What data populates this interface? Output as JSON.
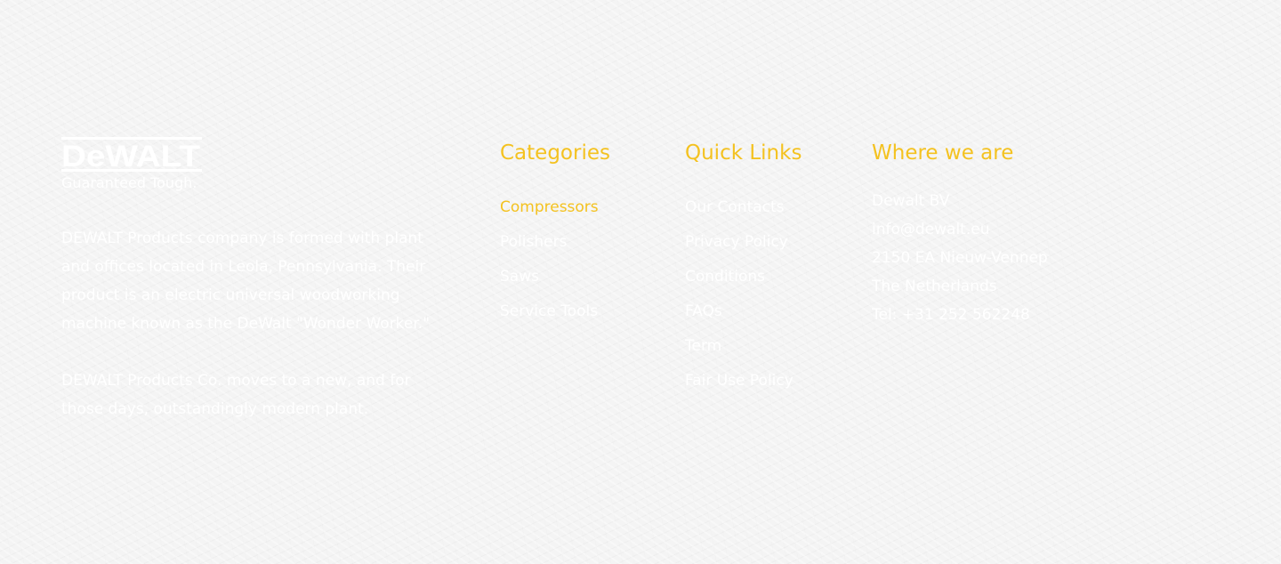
{
  "brand": {
    "logo_text": "DeWALT",
    "tagline": "Guaranteed Tough.",
    "about_paragraphs": [
      "DEWALT Products company is formed with plant and offices located in Leola, Pennsylvania. Their product is an electric universal woodworking machine known as the DeWalt \"Wonder Worker.\"",
      "DEWALT Products Co. moves to a new, and for those days, outstandingly modern plant."
    ]
  },
  "categories": {
    "heading": "Categories",
    "items": [
      "Compressors",
      "Polishers",
      "Saws",
      "Service Tools"
    ],
    "active_index": 0
  },
  "quick_links": {
    "heading": "Quick Links",
    "items": [
      "Our Contacts",
      "Privacy Policy",
      "Conditions",
      "FAQs",
      "Term",
      "Fair Use Policy"
    ]
  },
  "where_we_are": {
    "heading": "Where we are",
    "lines": [
      "Dewalt BV",
      "info@dewalt.eu",
      "2150 EA Nieuw-Vennep",
      "The Netherlands",
      "Tel: +31 252 562248"
    ]
  },
  "colors": {
    "accent": "#f4c220",
    "text": "#ffffff",
    "background": "#f4f4f4"
  }
}
